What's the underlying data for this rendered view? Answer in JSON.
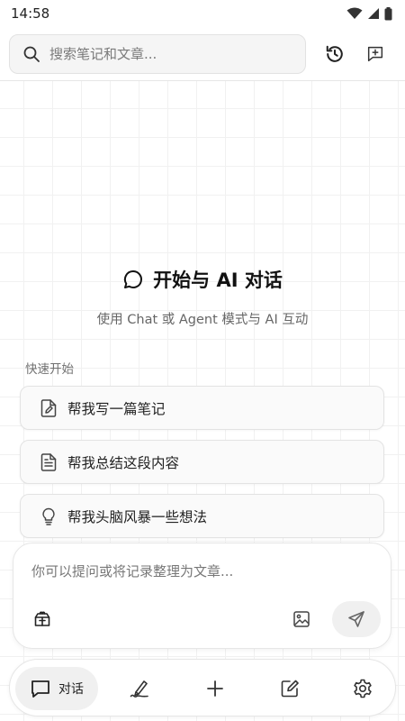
{
  "status": {
    "time": "14:58"
  },
  "search": {
    "placeholder": "搜索笔记和文章..."
  },
  "welcome": {
    "title": "开始与 AI 对话",
    "subtitle": "使用 Chat 或 Agent 模式与 AI 互动"
  },
  "quick_start": {
    "label": "快速开始",
    "items": [
      {
        "label": "帮我写一篇笔记",
        "icon": "document-pen-icon"
      },
      {
        "label": "帮我总结这段内容",
        "icon": "document-text-icon"
      },
      {
        "label": "帮我头脑风暴一些想法",
        "icon": "lightbulb-icon"
      }
    ]
  },
  "composer": {
    "placeholder": "你可以提问或将记录整理为文章..."
  },
  "nav": {
    "items": [
      {
        "label": "对话",
        "icon": "chat-icon",
        "active": true
      },
      {
        "icon": "handwriting-icon"
      },
      {
        "icon": "plus-icon"
      },
      {
        "icon": "edit-icon"
      },
      {
        "icon": "gear-icon"
      }
    ]
  },
  "colors": {
    "active_bg": "#f0f0f0",
    "border": "#e3e3e3",
    "text": "#222222"
  }
}
